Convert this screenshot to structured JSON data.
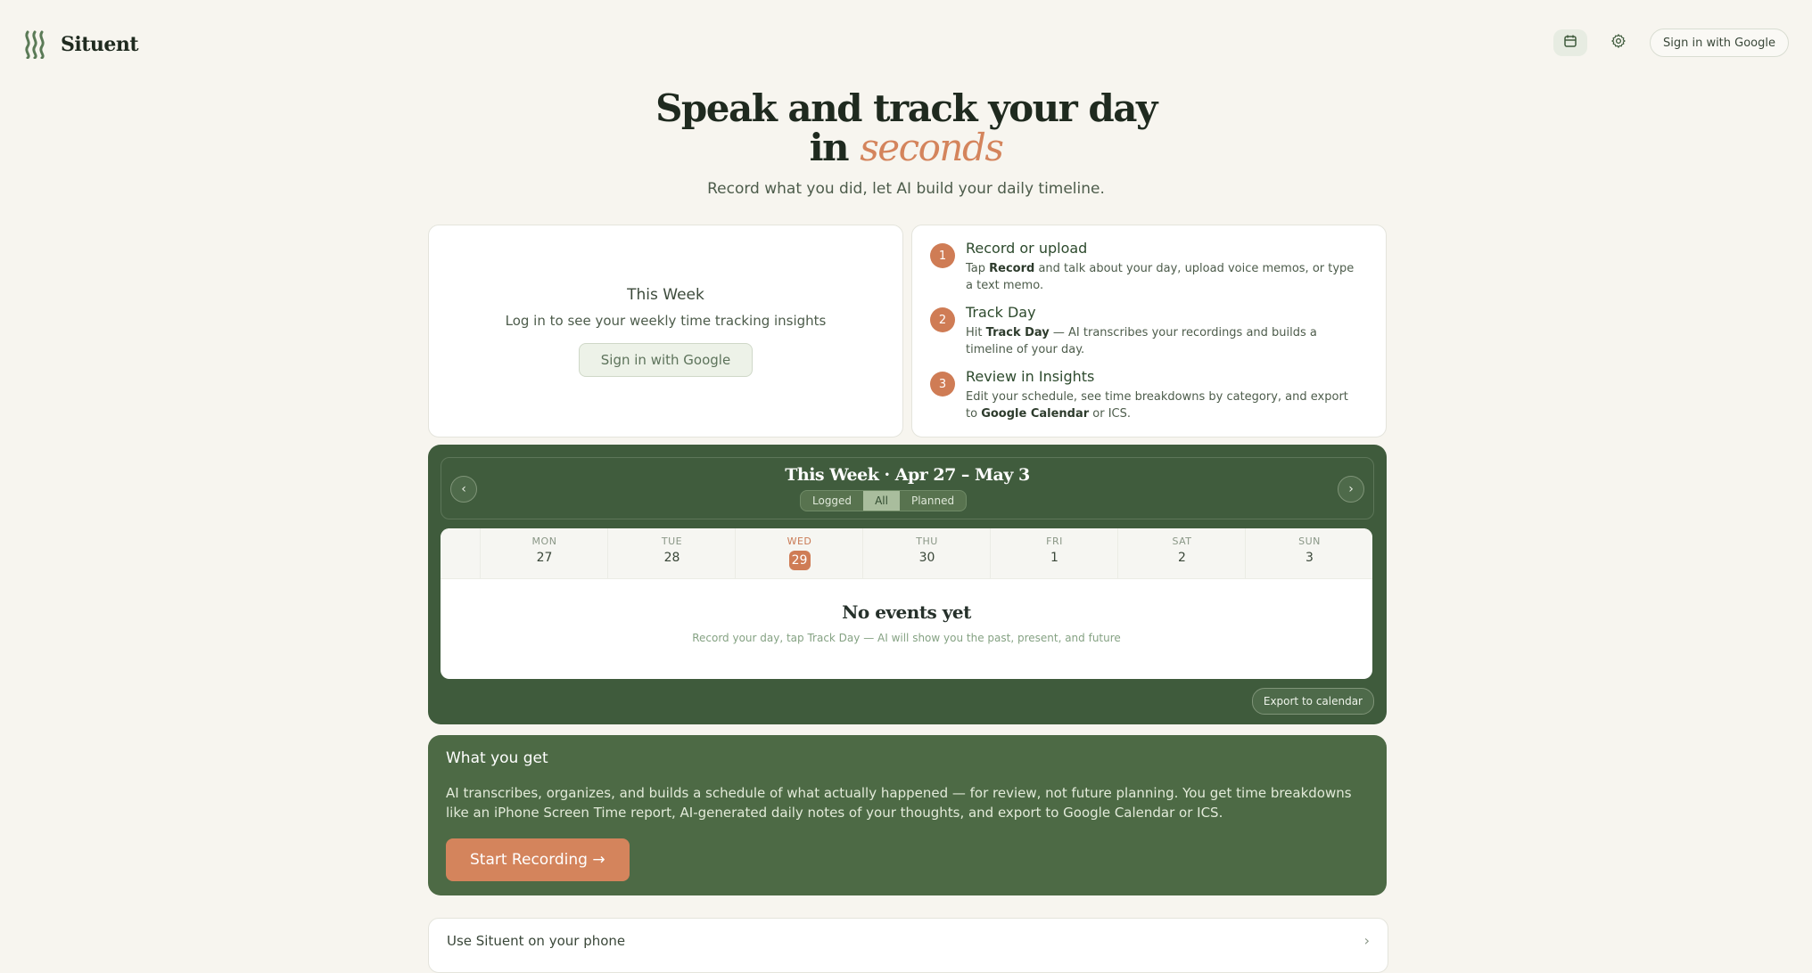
{
  "header": {
    "app_name": "Situent",
    "calendar_icon": "calendar-icon",
    "settings_icon": "gear-icon",
    "sign_in_label": "Sign in with Google"
  },
  "hero": {
    "title_line1": "Speak and track your day",
    "title_line2_prefix": "in",
    "title_line2_accent": "seconds",
    "subtitle": "Record what you did, let AI build your daily timeline."
  },
  "week_card": {
    "title": "This Week",
    "description": "Log in to see your weekly time tracking insights",
    "button_label": "Sign in with Google"
  },
  "steps": [
    {
      "num": "1",
      "title": "Record or upload",
      "pre": "Tap ",
      "bold": "Record",
      "post": " and talk about your day, upload voice memos, or type a text memo."
    },
    {
      "num": "2",
      "title": "Track Day",
      "pre": "Hit ",
      "bold": "Track Day",
      "post": " — AI transcribes your recordings and builds a timeline of your day."
    },
    {
      "num": "3",
      "title": "Review in Insights",
      "pre": "Edit your schedule, see time breakdowns by category, and export to ",
      "bold": "Google Calendar",
      "post": " or ICS."
    }
  ],
  "calendar": {
    "title": "This Week · Apr 27 – May 3",
    "prev_label": "‹",
    "next_label": "›",
    "filters": [
      "Logged",
      "All",
      "Planned"
    ],
    "active_filter": "All",
    "days": [
      {
        "name": "MON",
        "date": "27"
      },
      {
        "name": "TUE",
        "date": "28"
      },
      {
        "name": "WED",
        "date": "29",
        "today": true
      },
      {
        "name": "THU",
        "date": "30"
      },
      {
        "name": "FRI",
        "date": "1"
      },
      {
        "name": "SAT",
        "date": "2"
      },
      {
        "name": "SUN",
        "date": "3"
      }
    ],
    "empty_title": "No events yet",
    "empty_subtitle": "Record your day, tap Track Day — AI will show you the past, present, and future",
    "export_label": "Export to calendar"
  },
  "what_you_get": {
    "title": "What you get",
    "body": "AI transcribes, organizes, and builds a schedule of what actually happened — for review, not future planning. You get time breakdowns like an iPhone Screen Time report, AI-generated daily notes of your thoughts, and export to Google Calendar or ICS.",
    "cta_label": "Start Recording →"
  },
  "phone_row": {
    "label": "Use Situent on your phone",
    "chevron": "›"
  },
  "colors": {
    "background": "#f7f5ef",
    "primary_green": "#3f5b3c",
    "accent": "#d4845c"
  }
}
